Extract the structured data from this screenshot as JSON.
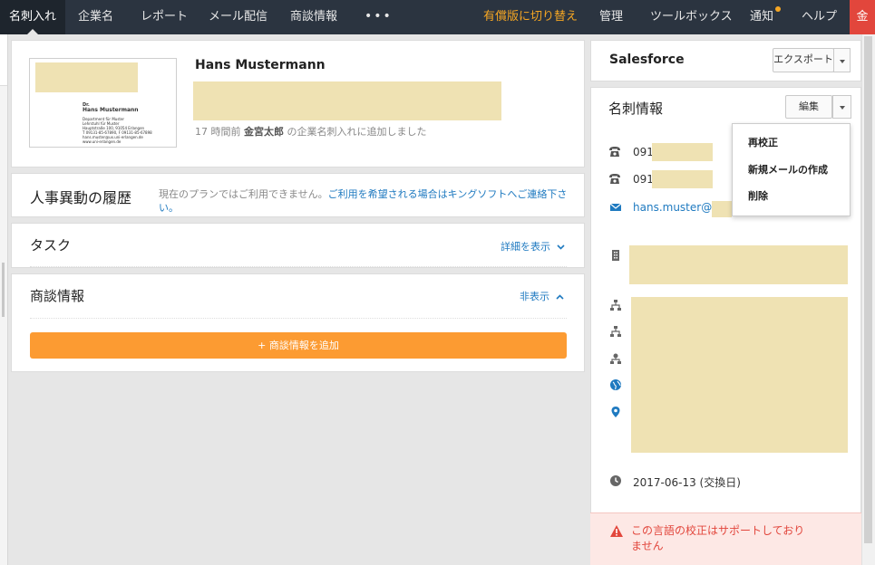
{
  "nav": {
    "items": [
      "名刺入れ",
      "企業名",
      "レポート",
      "メール配信",
      "商談情報"
    ],
    "more": "•••",
    "upgrade": "有償版に切り替え",
    "right_items": [
      "管理",
      "ツールボックス",
      "通知",
      "ヘルプ"
    ],
    "user_initial": "金"
  },
  "contact": {
    "name": "Hans Mustermann",
    "added_time": "17 時間前",
    "added_by": "金宮太郎",
    "added_suffix": "の企業名刺入れに追加しました"
  },
  "biz_card_text": {
    "title": "Dr.",
    "name": "Hans Mustermann",
    "lines": [
      "Department für Muster",
      "Lehrstuhl für Muster",
      "Hauptstraße 100, 91054 Erlangen",
      "T 09131-85-67890, F 09131-85-67898",
      "hans.muster@ux.uni-erlangen.de",
      "www.uni-erlangen.de"
    ]
  },
  "sections": {
    "history": {
      "title": "人事異動の履歴",
      "note_plain": "現在のプランではご利用できません。",
      "note_link": "ご利用を希望される場合はキングソフトへご連絡下さい。"
    },
    "task": {
      "title": "タスク",
      "toggle": "詳細を表示"
    },
    "deal": {
      "title": "商談情報",
      "toggle": "非表示",
      "add_button": "+ 商談情報を追加"
    }
  },
  "salesforce": {
    "title": "Salesforce",
    "export_label": "エクスポート"
  },
  "meishi": {
    "title": "名刺情報",
    "edit_label": "編集",
    "menu": [
      "再校正",
      "新規メールの作成",
      "削除"
    ],
    "phone1": "091",
    "phone2": "091",
    "email": "hans.muster@",
    "exchange_date": "2017-06-13 (交換日)"
  },
  "alert": {
    "text": "この言語の校正はサポートしておりません"
  },
  "colors": {
    "nav_bg": "#2b3440",
    "accent_orange": "#fc9b32",
    "link_blue": "#1f7ac0",
    "alert_red": "#e2463c"
  }
}
